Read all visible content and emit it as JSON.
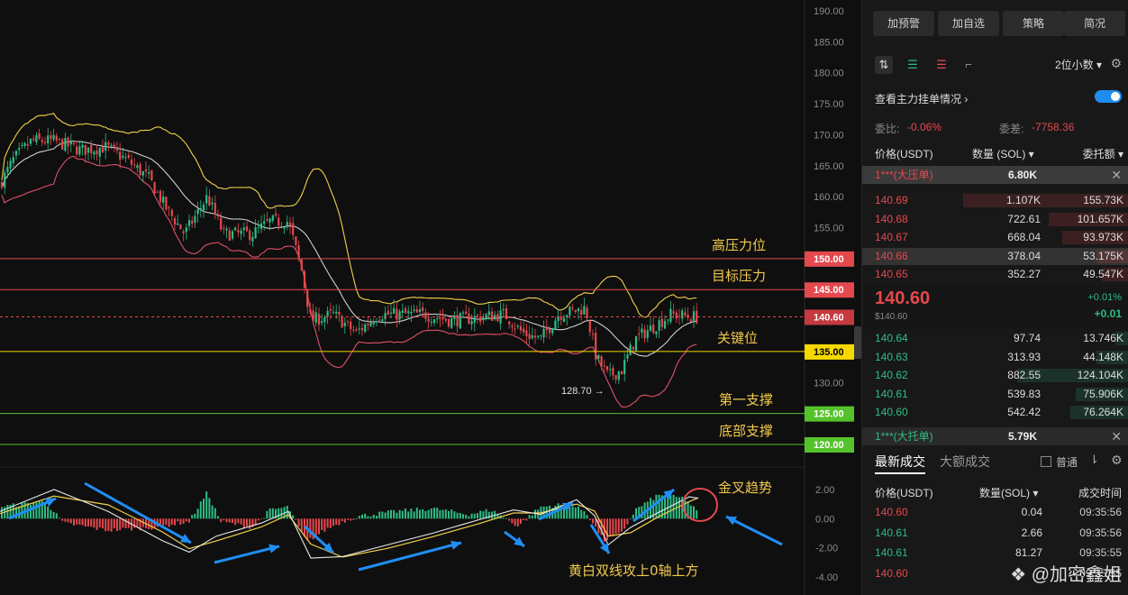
{
  "chart": {
    "axis_labels": [
      "190.00",
      "185.00",
      "180.00",
      "175.00",
      "170.00",
      "165.00",
      "160.00",
      "155.00",
      "150.00",
      "145.00",
      "140.60",
      "135.00",
      "130.00",
      "125.00",
      "120.00"
    ],
    "price_ticks": [
      190,
      185,
      180,
      175,
      170,
      165,
      160,
      155,
      130
    ],
    "levels": [
      {
        "price": 150,
        "label": "150.00",
        "color": "#e5484d",
        "line": "#e5484d",
        "text": "高压力位"
      },
      {
        "price": 145,
        "label": "145.00",
        "color": "#e5484d",
        "line": "#e5484d",
        "text": "目标压力"
      },
      {
        "price": 135,
        "label": "135.00",
        "color": "#f5d800",
        "line": "#f5d800",
        "text": "关键位"
      },
      {
        "price": 125,
        "label": "125.00",
        "color": "#56c22b",
        "line": "#56c22b",
        "text": "第一支撑"
      },
      {
        "price": 120,
        "label": "120.00",
        "color": "#56c22b",
        "line": "#56c22b",
        "text": "底部支撑"
      }
    ],
    "current_price": {
      "price": 140.6,
      "label": "140.60"
    },
    "low_marker": "128.70 →",
    "macd_ticks": [
      "2.00",
      "0.00",
      "-2.00",
      "-4.00"
    ],
    "macd_annotation_top": "金叉趋势",
    "macd_annotation_bottom": "黄白双线攻上0轴上方",
    "colors": {
      "up": "#2dbd85",
      "down": "#e5484d",
      "band_upper": "#f2d04a",
      "band_mid": "#cfcfcf",
      "band_lower": "#e0506a",
      "arrow": "#1f8ef5"
    }
  },
  "panel": {
    "buttons": [
      "加预警",
      "加自选",
      "策略",
      "简况"
    ],
    "decimals": "2位小数 ▾",
    "main_orders": "查看主力挂单情况 ›",
    "weibi_label": "委比:",
    "weibi_value": "-0.06%",
    "weicha_label": "委差:",
    "weicha_value": "-7758.36",
    "header": {
      "price": "价格(USDT)",
      "qty": "数量 (SOL) ▾",
      "total": "委托额 ▾"
    },
    "big_ask": {
      "label": "1***(大压单)",
      "value": "6.80K"
    },
    "asks": [
      {
        "p": "140.69",
        "q": "1.107K",
        "t": "155.73K",
        "d": 0.62
      },
      {
        "p": "140.68",
        "q": "722.61",
        "t": "101.657K",
        "d": 0.3
      },
      {
        "p": "140.67",
        "q": "668.04",
        "t": "93.973K",
        "d": 0.25
      },
      {
        "p": "140.66",
        "q": "378.04",
        "t": "53.175K",
        "d": 0.12
      },
      {
        "p": "140.65",
        "q": "352.27",
        "t": "49.547K",
        "d": 0.1
      }
    ],
    "last_price": "140.60",
    "last_price_usd": "$140.60",
    "change_pct": "+0.01%",
    "change": "+0.01",
    "bids": [
      {
        "p": "140.64",
        "q": "97.74",
        "t": "13.746K",
        "d": 0.05
      },
      {
        "p": "140.63",
        "q": "313.93",
        "t": "44.148K",
        "d": 0.12
      },
      {
        "p": "140.62",
        "q": "882.55",
        "t": "124.104K",
        "d": 0.42
      },
      {
        "p": "140.61",
        "q": "539.83",
        "t": "75.906K",
        "d": 0.2
      },
      {
        "p": "140.60",
        "q": "542.42",
        "t": "76.264K",
        "d": 0.22
      }
    ],
    "big_bid": {
      "label": "1***(大托单)",
      "value": "5.79K"
    },
    "tabs": {
      "latest": "最新成交",
      "large": "大额成交",
      "normal": "普通"
    },
    "trade_header": {
      "price": "价格(USDT)",
      "qty": "数量(SOL) ▾",
      "time": "成交时间"
    },
    "trades": [
      {
        "p": "140.60",
        "q": "0.04",
        "t": "09:35:56",
        "side": "red"
      },
      {
        "p": "140.61",
        "q": "2.66",
        "t": "09:35:56",
        "side": "green"
      },
      {
        "p": "140.61",
        "q": "81.27",
        "t": "09:35:55",
        "side": "green"
      },
      {
        "p": "140.60",
        "q": "",
        "t": "09:35:55",
        "side": "red"
      }
    ],
    "watermark": "❖ @加密鑫姐"
  }
}
